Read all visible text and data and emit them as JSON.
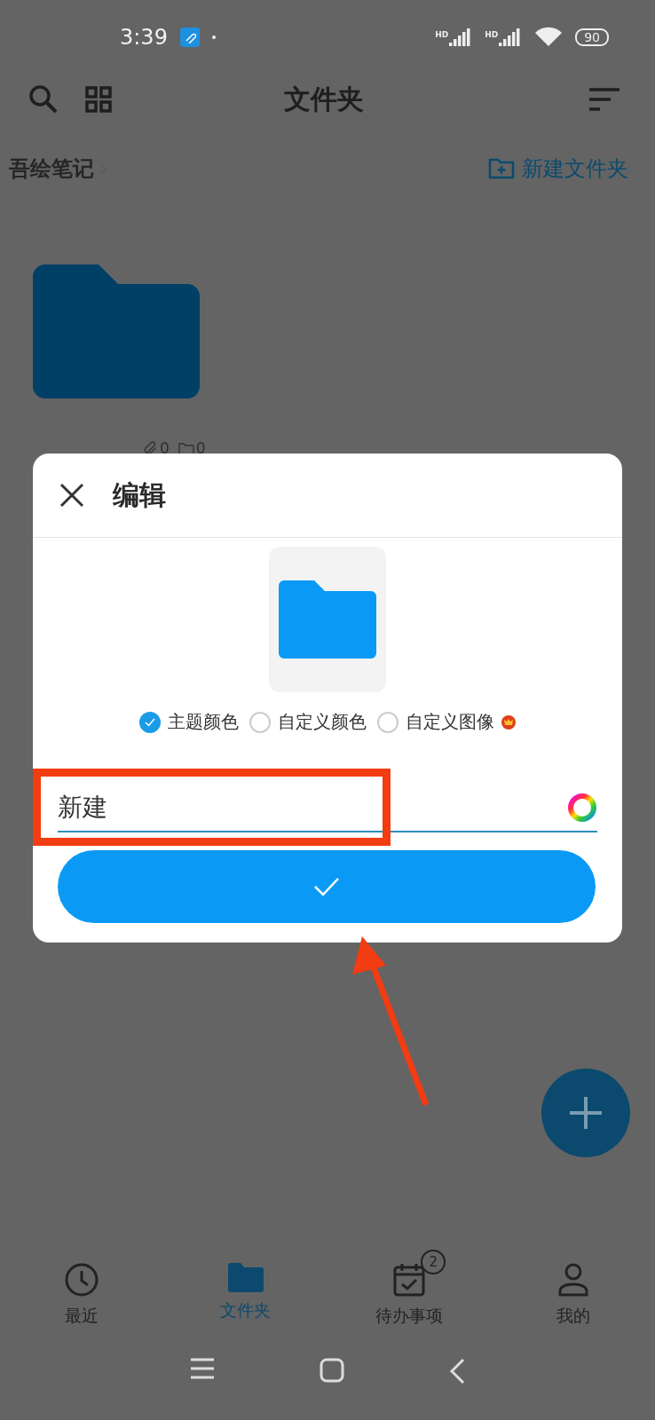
{
  "status_bar": {
    "time": "3:39",
    "signals": [
      {
        "label": "HD"
      },
      {
        "label": "HD"
      }
    ],
    "battery": "90"
  },
  "toolbar": {
    "title": "文件夹"
  },
  "breadcrumb": {
    "path": "吾绘笔记",
    "new_folder": "新建文件夹"
  },
  "folder": {
    "notes_count": "0",
    "folders_count": "0"
  },
  "dialog": {
    "title": "编辑",
    "options": [
      {
        "label": "主题颜色",
        "selected": true,
        "premium": false
      },
      {
        "label": "自定义颜色",
        "selected": false,
        "premium": false
      },
      {
        "label": "自定义图像",
        "selected": false,
        "premium": true
      }
    ],
    "name_field": {
      "value": "新建"
    }
  },
  "bottom_nav": [
    {
      "label": "最近",
      "kind": "clock",
      "selected": false
    },
    {
      "label": "文件夹",
      "kind": "folder",
      "selected": true
    },
    {
      "label": "待办事项",
      "kind": "calendar",
      "selected": false,
      "badge": "2"
    },
    {
      "label": "我的",
      "kind": "person",
      "selected": false
    }
  ]
}
